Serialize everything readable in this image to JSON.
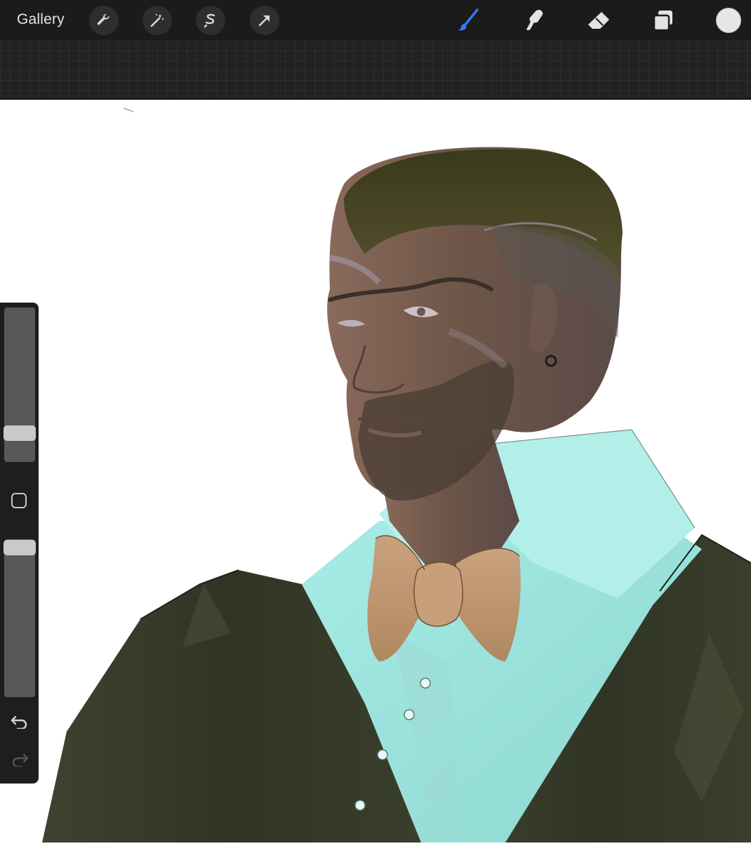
{
  "app": {
    "gallery_label": "Gallery"
  },
  "toolbar": {
    "left_tools": [
      "actions-icon",
      "adjustments-icon",
      "selection-icon",
      "transform-icon"
    ],
    "right_tools": [
      "brush-icon",
      "smudge-icon",
      "eraser-icon",
      "layers-icon",
      "color-icon"
    ],
    "active_tool": "brush-icon"
  },
  "colors": {
    "active_accent": "#2f7cf6",
    "current_color": "#e6e6e6",
    "toolbar_bg": "#1b1b1b",
    "canvas_bg": "#ffffff"
  },
  "sidebar": {
    "brush_size_level": 0.2,
    "opacity_level": 0.95,
    "tools": [
      "modify-icon",
      "undo-icon",
      "redo-icon"
    ],
    "redo_enabled": false
  },
  "canvas": {
    "content": "painting-portrait"
  }
}
